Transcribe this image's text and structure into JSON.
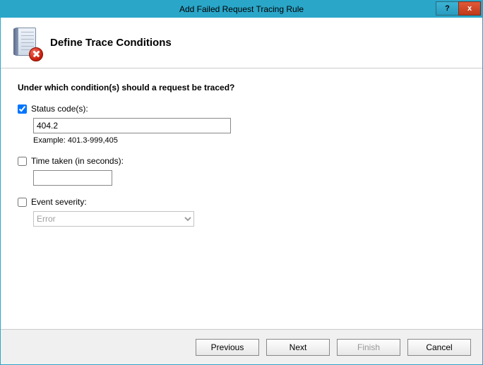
{
  "window": {
    "title": "Add Failed Request Tracing Rule",
    "help_glyph": "?",
    "close_glyph": "x"
  },
  "header": {
    "title": "Define Trace Conditions"
  },
  "form": {
    "question": "Under which condition(s) should a request be traced?",
    "status": {
      "label": "Status code(s):",
      "checked": true,
      "value": "404.2",
      "example": "Example: 401.3-999,405"
    },
    "time": {
      "label": "Time taken (in seconds):",
      "checked": false,
      "value": ""
    },
    "severity": {
      "label": "Event severity:",
      "checked": false,
      "selected": "Error"
    }
  },
  "footer": {
    "previous": "Previous",
    "next": "Next",
    "finish": "Finish",
    "cancel": "Cancel"
  }
}
